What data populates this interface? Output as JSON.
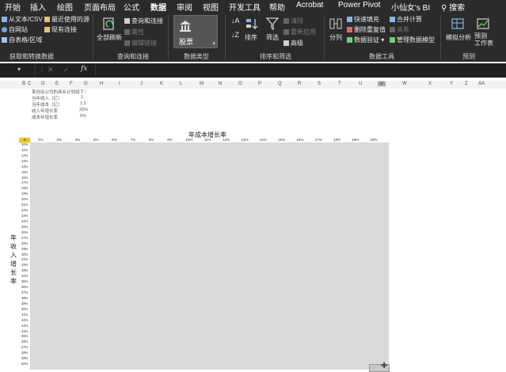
{
  "tabs": [
    "开始",
    "插入",
    "绘图",
    "页面布局",
    "公式",
    "数据",
    "审阅",
    "视图",
    "开发工具",
    "帮助",
    "Acrobat",
    "Power Pivot",
    "小仙女's BI",
    "搜索"
  ],
  "active_tab": "数据",
  "ribbon": {
    "get_data": {
      "from_text_csv": "从文本/CSV",
      "from_web": "自网站",
      "from_table": "自表格/区域",
      "recent_sources": "最近使用的源",
      "existing": "现有连接",
      "group": "获取和转换数据"
    },
    "queries": {
      "refresh_all": "全部刷新",
      "queries_connections": "查询和连接",
      "properties": "属性",
      "edit_links": "编辑链接",
      "group": "查询和连接"
    },
    "data_types": {
      "stocks": "股票",
      "group": "数据类型"
    },
    "sort_filter": {
      "sort": "排序",
      "filter": "筛选",
      "clear": "清除",
      "reapply": "重新应用",
      "advanced": "高级",
      "group": "排序和筛选"
    },
    "data_tools": {
      "text_to_columns": "分列",
      "flash_fill": "快速填充",
      "remove_duplicates": "删除重复值",
      "validation": "数据验证",
      "consolidate": "合并计算",
      "relationships": "关系",
      "manage_model": "管理数据模型",
      "group": "数据工具"
    },
    "forecast": {
      "what_if": "模拟分析",
      "forecast_sheet": "预测\n工作表",
      "group": "预测"
    }
  },
  "formula_bar": {
    "fx": "fx",
    "cancel": "✕",
    "confirm": "✓"
  },
  "columns": [
    "B",
    "C",
    "D",
    "E",
    "F",
    "G",
    "H",
    "I",
    "J",
    "K",
    "L",
    "M",
    "N",
    "O",
    "P",
    "Q",
    "R",
    "S",
    "T",
    "U",
    "V",
    "W",
    "X",
    "Y",
    "Z",
    "AA"
  ],
  "info_lines": [
    "某创业公司的商业计划如下：",
    "当年收入（亿）",
    "当年成本（亿）",
    "收入年增长率",
    "成本年增长率"
  ],
  "info_values": [
    "1",
    "1.5",
    "25%",
    "5%"
  ],
  "x_title": "年成本增长率",
  "y_title": "年收入增长率",
  "corner_value": "5",
  "x_ticks": [
    "2%",
    "3%",
    "4%",
    "5%",
    "6%",
    "7%",
    "8%",
    "9%",
    "10%",
    "11%",
    "12%",
    "13%",
    "14%",
    "15%",
    "16%",
    "17%",
    "18%",
    "19%",
    "20%"
  ],
  "y_ticks": [
    "10%",
    "11%",
    "12%",
    "13%",
    "14%",
    "15%",
    "16%",
    "17%",
    "18%",
    "19%",
    "20%",
    "21%",
    "22%",
    "23%",
    "24%",
    "25%",
    "26%",
    "27%",
    "28%",
    "29%",
    "30%",
    "31%",
    "32%",
    "33%",
    "34%",
    "35%",
    "36%",
    "37%",
    "38%",
    "39%",
    "40%",
    "41%",
    "42%",
    "43%",
    "44%",
    "45%",
    "46%",
    "47%",
    "48%",
    "49%",
    "50%"
  ],
  "colors": {
    "ribbon_bg": "#2b2b2b",
    "accent": "#4a9d4a",
    "grid_fill": "#d9d9d9",
    "corner": "#f5c518"
  }
}
